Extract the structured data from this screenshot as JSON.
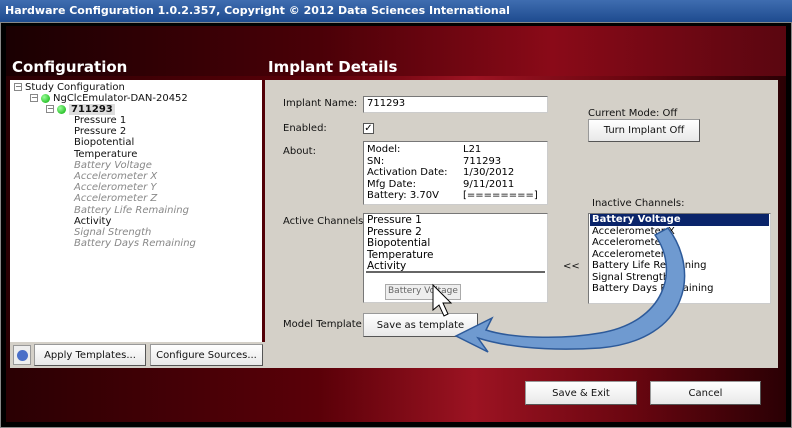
{
  "window": {
    "title": "Hardware Configuration 1.0.2.357, Copyright © 2012 Data Sciences International"
  },
  "left": {
    "heading": "Configuration",
    "tree": {
      "root": "Study Configuration",
      "device": "NgClcEmulator-DAN-20452",
      "implant": "711293",
      "channels": [
        {
          "label": "Pressure 1",
          "active": true
        },
        {
          "label": "Pressure 2",
          "active": true
        },
        {
          "label": "Biopotential",
          "active": true
        },
        {
          "label": "Temperature",
          "active": true
        },
        {
          "label": "Battery Voltage",
          "active": false
        },
        {
          "label": "Accelerometer X",
          "active": false
        },
        {
          "label": "Accelerometer Y",
          "active": false
        },
        {
          "label": "Accelerometer Z",
          "active": false
        },
        {
          "label": "Battery Life Remaining",
          "active": false
        },
        {
          "label": "Activity",
          "active": true
        },
        {
          "label": "Signal Strength",
          "active": false
        },
        {
          "label": "Battery Days Remaining",
          "active": false
        }
      ]
    },
    "buttons": {
      "apply": "Apply Templates...",
      "configure": "Configure Sources..."
    }
  },
  "details": {
    "heading": "Implant Details",
    "implant_name_label": "Implant Name:",
    "implant_name": "711293",
    "enabled_label": "Enabled:",
    "enabled": true,
    "about_label": "About:",
    "about": [
      [
        "Model:",
        "L21"
      ],
      [
        "SN:",
        "711293"
      ],
      [
        "Activation Date:",
        "1/30/2012"
      ],
      [
        "Mfg Date:",
        "9/11/2011"
      ],
      [
        "Battery: 3.70V",
        "[========]"
      ]
    ],
    "active_label": "Active Channels:",
    "active_channels": [
      "Pressure 1",
      "Pressure 2",
      "Biopotential",
      "Temperature",
      "Activity"
    ],
    "drag_item": "Battery Voltage",
    "model_template_label": "Model Template:",
    "save_template": "Save as template",
    "current_mode": "Current Mode: Off",
    "turn_off": "Turn Implant Off",
    "inactive_label": "Inactive Channels:",
    "move_left": "<<",
    "inactive_channels": [
      "Battery Voltage",
      "Accelerometer X",
      "Accelerometer Y",
      "Accelerometer Z",
      "Battery Life Remaining",
      "Signal Strength",
      "Battery Days Remaining"
    ]
  },
  "footer": {
    "save": "Save & Exit",
    "cancel": "Cancel"
  }
}
